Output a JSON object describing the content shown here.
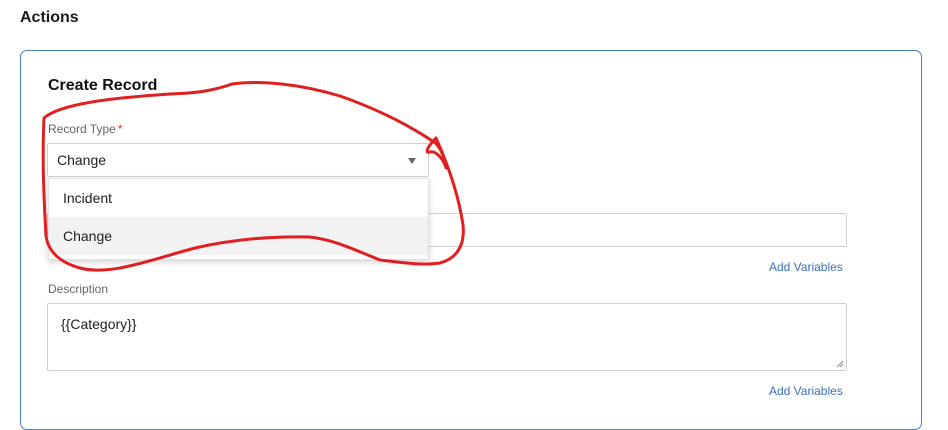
{
  "section": {
    "title": "Actions"
  },
  "card": {
    "title": "Create Record",
    "record_type": {
      "label": "Record Type",
      "required_mark": "*",
      "selected": "Change",
      "options": [
        "Incident",
        "Change"
      ]
    },
    "name_field": {
      "value": "",
      "add_variables": "Add Variables"
    },
    "description": {
      "label": "Description",
      "value": "{{Category}}",
      "add_variables": "Add Variables"
    }
  },
  "annotation": {
    "color": "#e02020"
  }
}
